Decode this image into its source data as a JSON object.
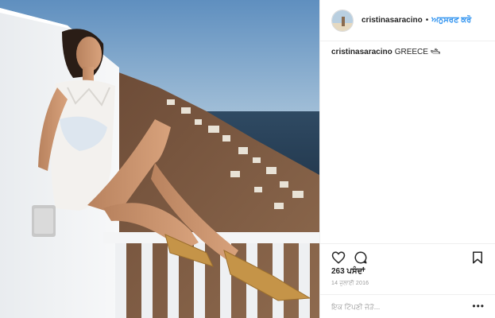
{
  "header": {
    "username": "cristinasaracino",
    "separator": "•",
    "follow_label": "ਅਨੁਸਰਣ ਕਰੋ"
  },
  "caption": {
    "username": "cristinasaracino",
    "text": "GREECE 🛥"
  },
  "actions": {
    "like_icon": "heart-icon",
    "comment_icon": "comment-icon",
    "save_icon": "bookmark-icon"
  },
  "likes": "263 ਪਸੰਦਾਂ",
  "date": "14 ਜੁਲਾਈ 2016",
  "comment_box": {
    "placeholder": "ਇਕ ਟਿੱਪਣੀ ਜੋੜੋ...",
    "more_label": "•••"
  },
  "colors": {
    "follow_blue": "#3897f0",
    "border": "#efefef",
    "muted_text": "#999999"
  }
}
